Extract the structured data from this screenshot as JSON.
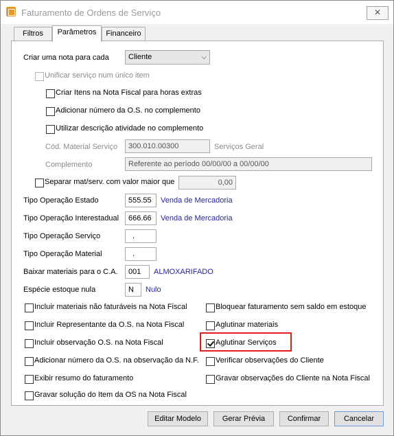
{
  "window": {
    "title": "Faturamento de Ordens de Serviço",
    "close_label": "✕"
  },
  "tabs": [
    {
      "label": "Filtros"
    },
    {
      "label": "Parâmetros"
    },
    {
      "label": "Financeiro"
    }
  ],
  "form": {
    "criar_nota_label": "Criar uma nota para cada",
    "criar_nota_value": "Cliente",
    "unificar_label": "Unificar serviço num único item",
    "criar_itens_label": "Criar Itens na Nota Fiscal para horas extras",
    "adicionar_numero_label": "Adicionar número da O.S. no complemento",
    "utilizar_descricao_label": "Utilizar descrição atividade no complemento",
    "cod_material_label": "Cód. Material Serviço",
    "cod_material_value": "300.010.00300",
    "cod_material_desc": "Serviços Geral",
    "complemento_label": "Complemento",
    "complemento_value": "Referente ao período 00/00/00 a 00/00/00",
    "separar_label": "Separar mat/serv. com valor maior que",
    "separar_value": "0,00",
    "tipo_op_estado_label": "Tipo Operação Estado",
    "tipo_op_estado_value": "555.55",
    "tipo_op_estado_desc": "Venda de Mercadoria",
    "tipo_op_inter_label": "Tipo Operação Interestadual",
    "tipo_op_inter_value": "666.66",
    "tipo_op_inter_desc": "Venda de Mercadoria",
    "tipo_op_servico_label": "Tipo Operação Serviço",
    "tipo_op_servico_value": ".",
    "tipo_op_material_label": "Tipo Operação Material",
    "tipo_op_material_value": ".",
    "baixar_label": "Baixar materiais para o C.A.",
    "baixar_value": "001",
    "baixar_desc": "ALMOXARIFADO",
    "especie_label": "Espécie estoque nula",
    "especie_value": "N",
    "especie_desc": "Nulo"
  },
  "options_left": [
    {
      "label": "Incluir materiais não faturáveis na Nota Fiscal",
      "checked": false
    },
    {
      "label": "Incluir Representante da O.S. na Nota Fiscal",
      "checked": false
    },
    {
      "label": "Incluir observação O.S. na Nota Fiscal",
      "checked": false
    },
    {
      "label": "Adicionar número da O.S. na observação da N.F.",
      "checked": false
    },
    {
      "label": "Exibir resumo do faturamento",
      "checked": false
    },
    {
      "label": "Gravar solução do Item da OS na Nota Fiscal",
      "checked": false
    }
  ],
  "options_right": [
    {
      "label": "Bloquear faturamento sem saldo em estoque",
      "checked": false
    },
    {
      "label": "Aglutinar materiais",
      "checked": false
    },
    {
      "label": "Aglutinar Serviços",
      "checked": true
    },
    {
      "label": "Verificar observações do Cliente",
      "checked": false
    },
    {
      "label": "Gravar observações do Cliente na Nota Fiscal",
      "checked": false
    }
  ],
  "buttons": {
    "editar": "Editar Modelo",
    "gerar": "Gerar Prévia",
    "confirmar": "Confirmar",
    "cancelar": "Cancelar"
  },
  "colors": {
    "highlight": "#e41b1b",
    "link_blue": "#1f1fa8"
  }
}
